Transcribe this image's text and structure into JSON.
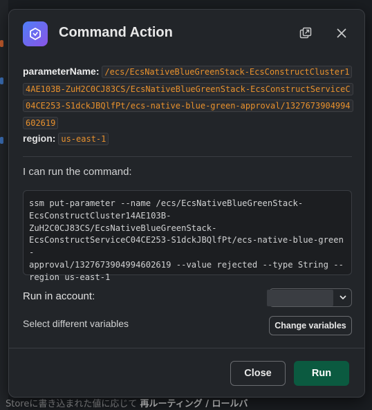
{
  "background": {
    "footer_text_prefix": "Storeに書き込まれた値に応じて",
    "footer_text_bold": "再ルーティング / ロールバ"
  },
  "modal": {
    "title": "Command Action",
    "app_icon": "workflow-logo-icon",
    "header_buttons": [
      {
        "name": "open-in-window-icon"
      },
      {
        "name": "close-icon"
      }
    ],
    "parameter_name": {
      "label": "parameterName",
      "value": "/ecs/EcsNativeBlueGreenStack-EcsConstructCluster14AE103B-ZuH2C0CJ83CS/EcsNativeBlueGreenStack-EcsConstructServiceC04CE253-S1dckJBQlfPt/ecs-native-blue-green-approval/1327673904994602619"
    },
    "region": {
      "label": "region",
      "value": "us-east-1"
    },
    "intro_text": "I can run the command:",
    "command": "ssm put-parameter --name /ecs/EcsNativeBlueGreenStack-\nEcsConstructCluster14AE103B-\nZuH2C0CJ83CS/EcsNativeBlueGreenStack-\nEcsConstructServiceC04CE253-S1dckJBQlfPt/ecs-native-blue-green-\napproval/1327673904994602619 --value rejected --type String --\nregion us-east-1",
    "run_in_account_label": "Run in account:",
    "select_variables_label": "Select different variables",
    "change_variables_button": "Change variables",
    "close_button": "Close",
    "run_button": "Run"
  },
  "colors": {
    "accent_run": "#0b5a40",
    "inline_code": "#e8912d",
    "modal_bg": "#222529"
  }
}
